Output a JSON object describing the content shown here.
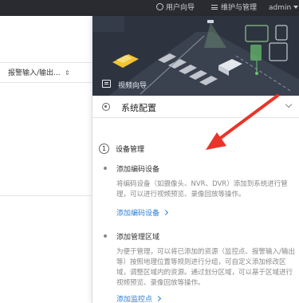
{
  "topbar": {
    "user_guide": "用户向导",
    "maintenance": "维护与管理",
    "user": "admin"
  },
  "background_app": {
    "filter_chip": "报警输入/输出..."
  },
  "guide_panel": {
    "banner_title": "视频向导",
    "section_title": "系统配置",
    "step": {
      "number": "1",
      "title": "设备管理"
    },
    "items": [
      {
        "title": "添加编码设备",
        "description": "将编码设备（如摄像头、NVR、DVR）添加到系统进行管理，可以进行视频预览、录像回放等操作。",
        "link": "添加编码设备"
      },
      {
        "title": "添加管理区域",
        "description": "为便于管理，可以将已添加的资源（监控点、报警输入/输出等）按照地理位置等规则进行分组，可自定义添加修改区域，调整区域内的资源。通过划分区域，可以基于区域进行视频预览、录像回放等操作。",
        "link": "添加监控点"
      }
    ]
  },
  "colors": {
    "topbar": "#2a2b30",
    "banner": "#2d3440",
    "link": "#2b7fd8",
    "annotation_arrow": "#e8342a"
  }
}
